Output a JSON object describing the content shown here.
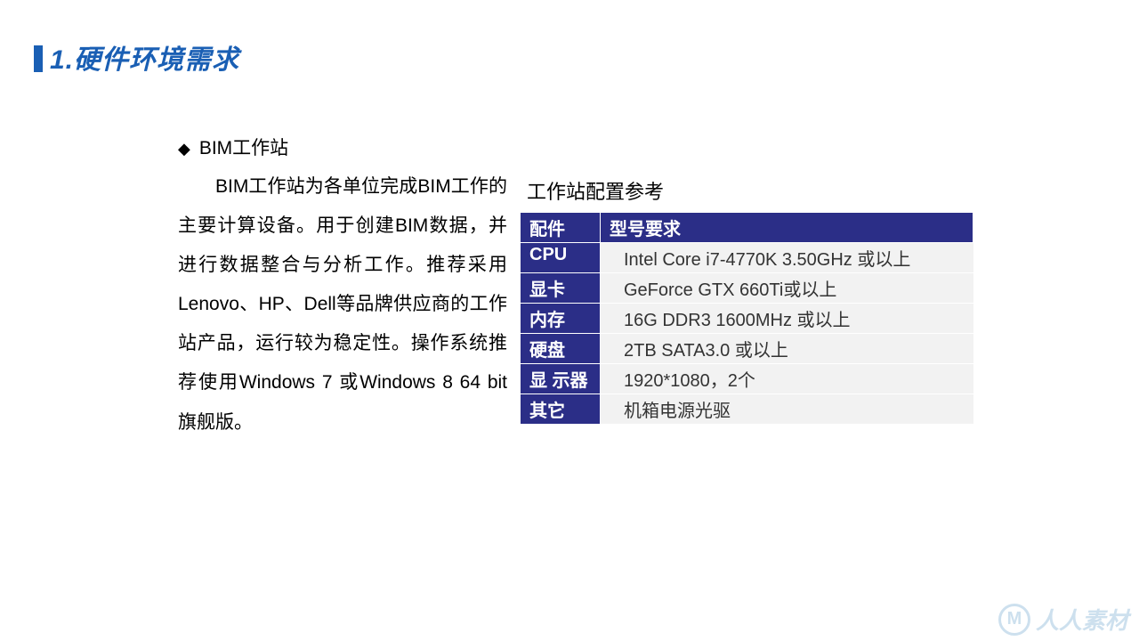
{
  "title": "1.硬件环境需求",
  "bullet_heading": "BIM工作站",
  "body": "BIM工作站为各单位完成BIM工作的主要计算设备。用于创建BIM数据，并进行数据整合与分析工作。推荐采用Lenovo、HP、Dell等品牌供应商的工作站产品，运行较为稳定性。操作系统推荐使用Windows 7 或Windows 8 64 bit旗舰版。",
  "table_title": "工作站配置参考",
  "table": {
    "head": {
      "c1": "配件",
      "c2": "型号要求"
    },
    "rows": [
      {
        "label": "CPU",
        "value": "Intel Core i7-4770K   3.50GHz 或以上"
      },
      {
        "label": "显卡",
        "value": "GeForce GTX 660Ti或以上"
      },
      {
        "label": "内存",
        "value": "16G  DDR3 1600MHz 或以上"
      },
      {
        "label": "硬盘",
        "value": "2TB  SATA3.0 或以上"
      },
      {
        "label": "显 示器",
        "value": "1920*1080，2个"
      },
      {
        "label": "其它",
        "value": "机箱电源光驱"
      }
    ]
  },
  "watermark": "人人素材"
}
